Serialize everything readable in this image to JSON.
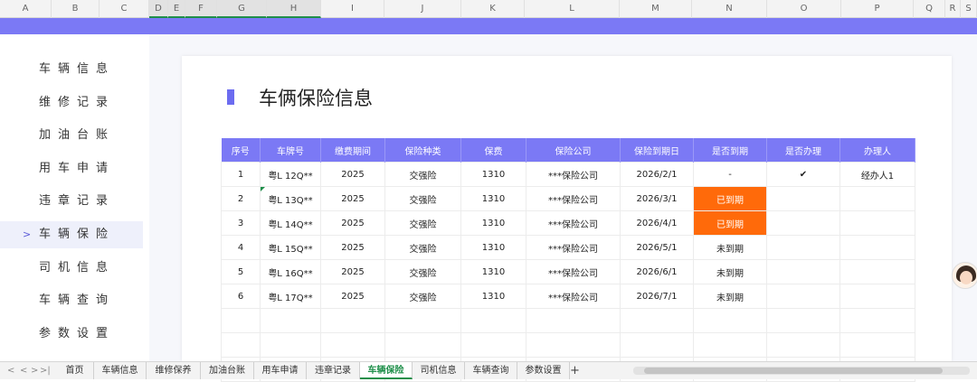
{
  "columns": [
    "A",
    "B",
    "C",
    "D",
    "E",
    "F",
    "G",
    "H",
    "I",
    "J",
    "K",
    "L",
    "M",
    "N",
    "O",
    "P",
    "Q",
    "R",
    "S"
  ],
  "sidebar": {
    "items": [
      {
        "label": "车辆信息",
        "active": false
      },
      {
        "label": "维修记录",
        "active": false
      },
      {
        "label": "加油台账",
        "active": false
      },
      {
        "label": "用车申请",
        "active": false
      },
      {
        "label": "违章记录",
        "active": false
      },
      {
        "label": "车辆保险",
        "active": true
      },
      {
        "label": "司机信息",
        "active": false
      },
      {
        "label": "车辆查询",
        "active": false
      },
      {
        "label": "参数设置",
        "active": false
      }
    ],
    "chevron": ">"
  },
  "page": {
    "title": "车俩保险信息"
  },
  "table": {
    "headers": [
      "序号",
      "车牌号",
      "缴费期间",
      "保险种类",
      "保费",
      "保险公司",
      "保险到期日",
      "是否到期",
      "是否办理",
      "办理人"
    ],
    "rows": [
      {
        "no": "1",
        "plate": "粤L 12Q**",
        "period": "2025",
        "type": "交强险",
        "fee": "1310",
        "company": "***保险公司",
        "due": "2026/2/1",
        "expired": "-",
        "handled": "✔",
        "handler": "经办人1",
        "overdue": false
      },
      {
        "no": "2",
        "plate": "粤L 13Q**",
        "period": "2025",
        "type": "交强险",
        "fee": "1310",
        "company": "***保险公司",
        "due": "2026/3/1",
        "expired": "已到期",
        "handled": "",
        "handler": "",
        "overdue": true
      },
      {
        "no": "3",
        "plate": "粤L 14Q**",
        "period": "2025",
        "type": "交强险",
        "fee": "1310",
        "company": "***保险公司",
        "due": "2026/4/1",
        "expired": "已到期",
        "handled": "",
        "handler": "",
        "overdue": true
      },
      {
        "no": "4",
        "plate": "粤L 15Q**",
        "period": "2025",
        "type": "交强险",
        "fee": "1310",
        "company": "***保险公司",
        "due": "2026/5/1",
        "expired": "未到期",
        "handled": "",
        "handler": "",
        "overdue": false
      },
      {
        "no": "5",
        "plate": "粤L 16Q**",
        "period": "2025",
        "type": "交强险",
        "fee": "1310",
        "company": "***保险公司",
        "due": "2026/6/1",
        "expired": "未到期",
        "handled": "",
        "handler": "",
        "overdue": false
      },
      {
        "no": "6",
        "plate": "粤L 17Q**",
        "period": "2025",
        "type": "交强险",
        "fee": "1310",
        "company": "***保险公司",
        "due": "2026/7/1",
        "expired": "未到期",
        "handled": "",
        "handler": "",
        "overdue": false
      }
    ]
  },
  "sheet_tabs": [
    "首页",
    "车辆信息",
    "维修保养",
    "加油台账",
    "用车申请",
    "违章记录",
    "车辆保险",
    "司机信息",
    "车辆查询",
    "参数设置"
  ],
  "active_tab": "车辆保险",
  "tab_nav": [
    "<",
    "<",
    ">",
    ">|"
  ],
  "add_tab": "+",
  "colors": {
    "accent": "#7b79f5",
    "overdue": "#ff6a0a",
    "active_tab": "#1f8f4a"
  }
}
